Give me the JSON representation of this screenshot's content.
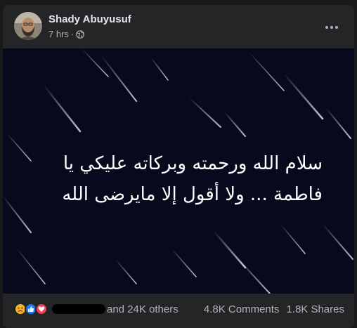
{
  "post": {
    "author": "Shady Abuyusuf",
    "time": "7 hrs",
    "separator": "·",
    "privacy_icon": "globe-icon",
    "more_icon": "more-options-icon"
  },
  "image": {
    "line1": "سلام الله ورحمته وبركاته عليكي يا",
    "line2": "فاطمة ... ولا أقول إلا مايرضى الله",
    "background_color": "#07091c"
  },
  "reactions": {
    "icons": [
      "sad-reaction-icon",
      "like-reaction-icon",
      "love-reaction-icon"
    ],
    "others_text": "and 24K others",
    "comments_text": "4.8K Comments",
    "shares_text": "1.8K Shares"
  },
  "colors": {
    "card_bg": "#242526",
    "primary_text": "#e4e6eb",
    "secondary_text": "#b0b3b8",
    "like_blue": "#1877f2",
    "love_red": "#f33e58",
    "sad_yellow": "#f7b125"
  }
}
